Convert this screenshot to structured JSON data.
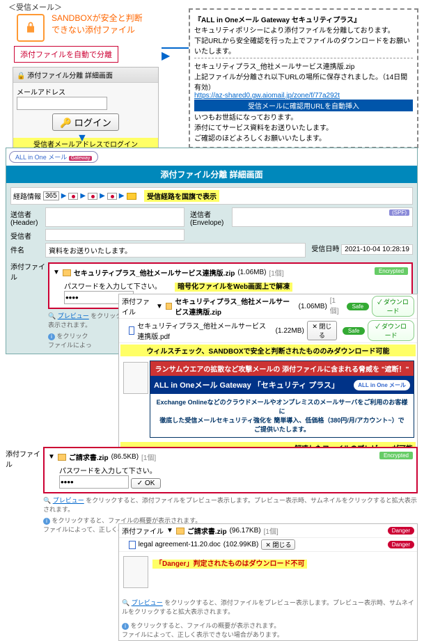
{
  "labels": {
    "received_mail": "＜受信メール＞",
    "sandbox_note_l1": "SANDBOXが安全と判断",
    "sandbox_note_l2": "できない添付ファイル",
    "auto_separate": "添付ファイルを自動で分離",
    "login_to_receiver": "受信者メールアドレスでログイン"
  },
  "email": {
    "title": "『ALL in Oneメール Gateway セキュリティプラス』",
    "line1": "セキュリティポリシーにより添付ファイルを分離しております。",
    "line2": "下記URLから安全確認を行った上でファイルのダウンロードをお願いいたします。",
    "filename": "セキュリティプラス_他社メールサービス連携版.zip",
    "saved_note": "上記ファイルが分離され以下URLの場所に保存されました。（14日間有効）",
    "url": "https://az-shared0.gw.aiomail.jp/zone/f/77a292t",
    "url_insert_note": "受信メールに確認用URLを自動挿入",
    "body1": "いつもお世話になっております。",
    "body2": "添付にてサービス資料をお送りいたします。",
    "body3": "ご確認のほどよろしくお願いいたします。"
  },
  "login": {
    "header": "添付ファイル分離 詳細画面",
    "mail_label": "メールアドレス",
    "login_btn": "ログイン"
  },
  "app": {
    "logo": "ALL in One メール",
    "gw": "Gateway",
    "title": "添付ファイル分離 詳細画面",
    "route_label": "経路情報",
    "route_365": "365",
    "route_note": "受信経路を国旗で表示",
    "sender_hdr": "送信者\n(Header)",
    "sender_env": "送信者\n(Envelope)",
    "recipient": "受信者",
    "spf": "(SPF)",
    "subject_label": "件名",
    "subject": "資料をお送りいたします。",
    "recv_dt_label": "受信日時",
    "recv_dt": "2021-10-04 10:28:19",
    "attach_label": "添付ファイル",
    "file1": "セキュリティプラス_他社メールサービス連携版.zip",
    "file1_size": "(1.06MB)",
    "one_item": "[1個]",
    "encrypted": "Encrypted",
    "pw_prompt": "パスワードを入力して下さい。",
    "ok": "OK",
    "decrypt_note": "暗号化ファイルをWeb画面上で解凍",
    "preview": "プレビュー",
    "preview_help": "をクリックすると、添付ファイルをプレビュー表示します。プレビュー表示時、サムネイルをクリックすると拡大表示されます。",
    "info_help1": "をクリック",
    "info_help2": "ファイルによっ",
    "attach_sub": "添付ファイル",
    "file2_pdf": "セキュリティプラス_他社メールサービス連携版.pdf",
    "file2_pdf_size": "(1.22MB)",
    "close": "閉じる",
    "safe": "Safe",
    "download": "ダウンロード",
    "virus_note": "ウィルスチェック、SANDBOXで安全と判断されたもののみダウンロード可能",
    "banner_red": "ランサムウエアの拡散など攻撃メールの 添付ファイルに含まれる脅威を \"遮断！\"",
    "banner_blue": "ALL in Oneメール Gateway 「セキュリティ プラス」",
    "banner_white1": "Exchange Onlineなどのクラウドメールやオンプレミスのメールサーバをご利用のお客様に",
    "banner_white2": "徹底した受信メールセキュリティ強化を 簡単導入、低価格（380円/月/アカウント~）で",
    "banner_white3": "ご提供いたします。",
    "extract_note": "解凍したファイルのプレビューが可能"
  },
  "sec2": {
    "file": "ご請求書.zip",
    "file_size": "(86.5KB)",
    "file_inner": "ご請求書.zip",
    "file_inner_size": "(96.17KB)",
    "doc": "legal agreement-11.20.doc",
    "doc_size": "(102.99KB)",
    "danger": "Danger",
    "danger_note": "「Danger」判定されたものはダウンロード不可",
    "help_full": "をクリックすると、添付ファイルをプレビュー表示します。プレビュー表示時、サムネイルをクリックすると拡大表示されます。",
    "help_info": "をクリックすると、ファイルの概要が表示されます。",
    "help_note": "ファイルによって、正しく表示できない場合があります。"
  }
}
